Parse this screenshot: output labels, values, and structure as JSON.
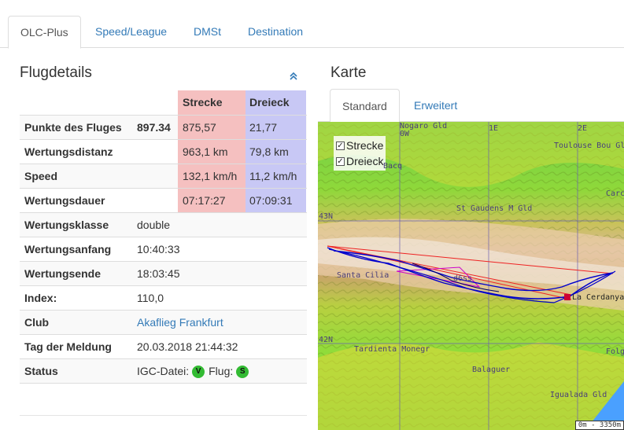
{
  "tabs": [
    "OLC-Plus",
    "Speed/League",
    "DMSt",
    "Destination"
  ],
  "details": {
    "title": "Flugdetails",
    "col_strecke": "Strecke",
    "col_dreieck": "Dreieck",
    "rows": [
      {
        "label": "Punkte des Fluges",
        "value": "897.34",
        "strecke": "875,57",
        "dreieck": "21,77"
      },
      {
        "label": "Wertungsdistanz",
        "value": "",
        "strecke": "963,1 km",
        "dreieck": "79,8 km"
      },
      {
        "label": "Speed",
        "value": "",
        "strecke": "132,1 km/h",
        "dreieck": "11,2 km/h"
      },
      {
        "label": "Wertungsdauer",
        "value": "",
        "strecke": "07:17:27",
        "dreieck": "07:09:31"
      },
      {
        "label": "Wertungsklasse",
        "value": "double"
      },
      {
        "label": "Wertungsanfang",
        "value": "10:40:33"
      },
      {
        "label": "Wertungsende",
        "value": "18:03:45"
      },
      {
        "label": "Index:",
        "value": "110,0"
      },
      {
        "label": "Club",
        "value": "Akaflieg Frankfurt"
      },
      {
        "label": "Tag der Meldung",
        "value": "20.03.2018 21:44:32"
      },
      {
        "label": "Status",
        "igc_label": "IGC-Datei:",
        "igc_badge": "V",
        "flug_label": "Flug:",
        "flug_badge": "S"
      }
    ],
    "badge_color": "#33bb33"
  },
  "map": {
    "title": "Karte",
    "tabs": [
      "Standard",
      "Erweitert"
    ],
    "layers": [
      "Strecke",
      "Dreieck"
    ],
    "labels": {
      "nogaro": "Nogaro Gld",
      "toulouse": "Toulouse Bou Gld",
      "st_gaudens": "St Gaudens M Gld",
      "santa_cilia": "Santa Cilia",
      "cerdanya": "La Cerdanya",
      "tardienta": "Tardienta Monegr",
      "balaguer": "Balaguer",
      "igualada": "Igualada Gld",
      "folgueroles": "Folg",
      "carc": "Carc",
      "aucq": "Bacq",
      "deg_1e": "1E",
      "deg_2e": "2E",
      "deg_0w": "0W",
      "lat_43": "43N",
      "lat_42": "42N",
      "d6": "d6ss"
    },
    "scale": "0m - 3350m",
    "track_color": "#0000cc",
    "strecke_color": "#ee2222",
    "dreieck_color": "#cc00cc"
  }
}
